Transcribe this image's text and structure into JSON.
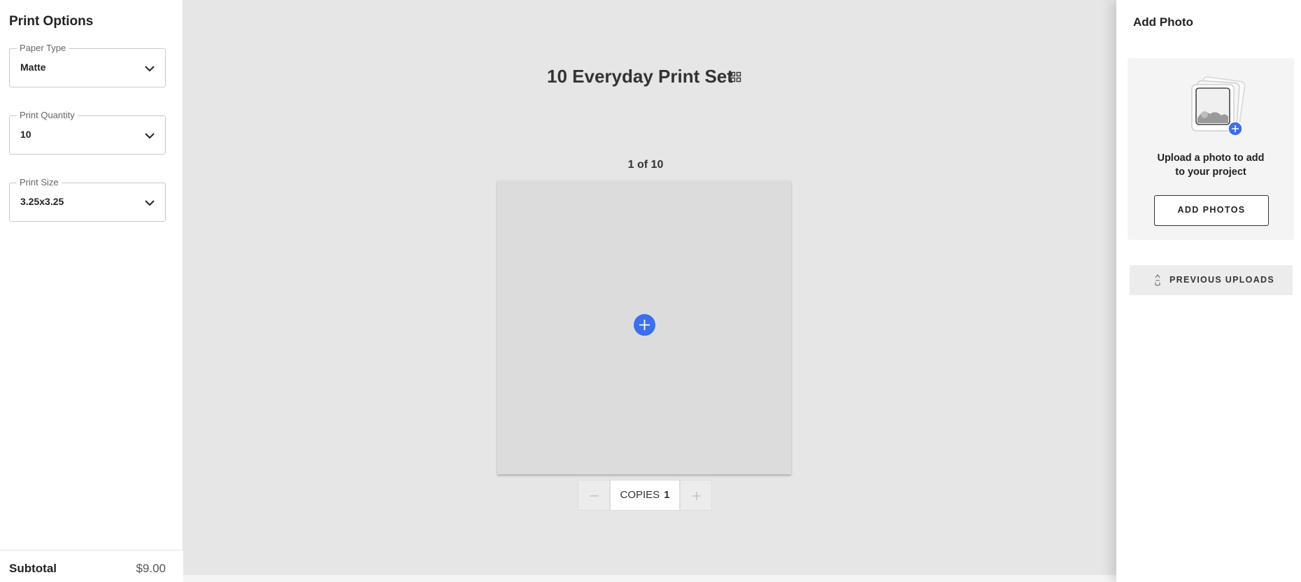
{
  "left_panel": {
    "title": "Print Options",
    "fields": [
      {
        "label": "Paper Type",
        "value": "Matte"
      },
      {
        "label": "Print Quantity",
        "value": "10"
      },
      {
        "label": "Print Size",
        "value": "3.25x3.25"
      }
    ],
    "subtotal_label": "Subtotal",
    "subtotal_value": "$9.00"
  },
  "canvas": {
    "project_title": "10 Everyday Print Set",
    "page_counter": "1 of 10",
    "copies_label": "COPIES",
    "copies_value": "1"
  },
  "right_panel": {
    "title": "Add Photo",
    "upload_prompt_line1": "Upload a photo to add",
    "upload_prompt_line2": "to your project",
    "add_photos_label": "ADD PHOTOS",
    "previous_uploads_label": "PREVIOUS UPLOADS"
  },
  "colors": {
    "accent_blue": "#3b6ff0",
    "canvas_bg": "#e6e6e6",
    "slot_bg": "#dcdcdc"
  },
  "icons": {
    "dropdown": "chevron-down-icon",
    "grid": "grid-view-icon",
    "add": "plus-circle-icon",
    "minus": "minus-icon",
    "plus": "plus-icon",
    "photo": "photo-stack-illustration",
    "sort": "sort-az-icon"
  }
}
